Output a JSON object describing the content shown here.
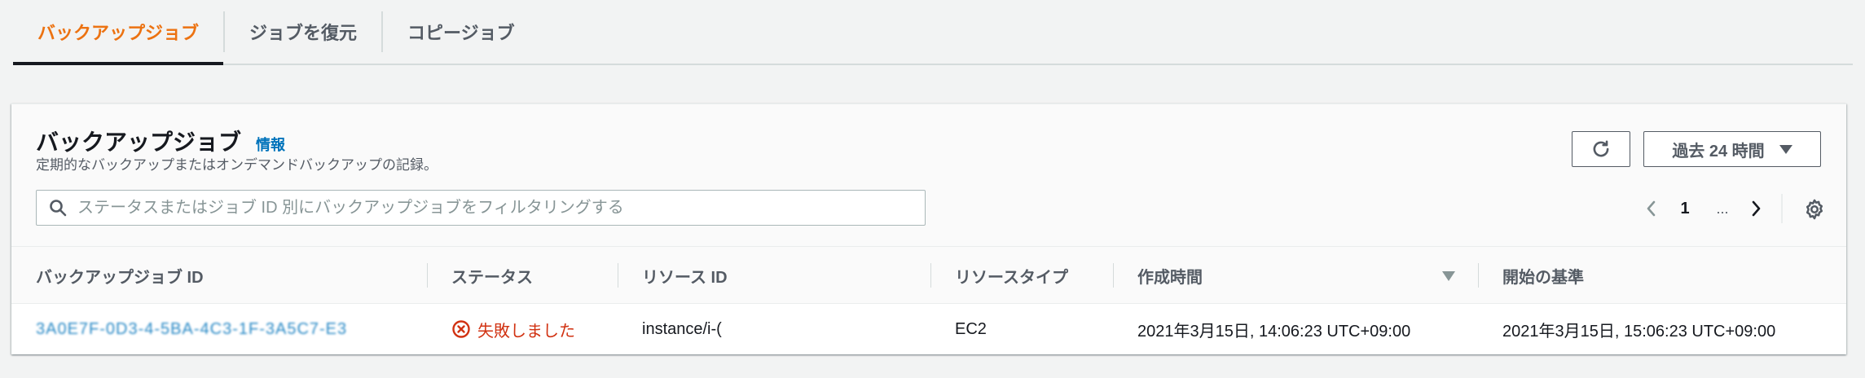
{
  "tabs": [
    {
      "label": "バックアップジョブ",
      "active": true
    },
    {
      "label": "ジョブを復元",
      "active": false
    },
    {
      "label": "コピージョブ",
      "active": false
    }
  ],
  "panel": {
    "title": "バックアップジョブ",
    "info_label": "情報",
    "description": "定期的なバックアップまたはオンデマンドバックアップの記録。",
    "time_range_label": "過去 24 時間"
  },
  "search": {
    "placeholder": "ステータスまたはジョブ ID 別にバックアップジョブをフィルタリングする",
    "value": ""
  },
  "pagination": {
    "current_page": "1",
    "ellipsis": "..."
  },
  "table": {
    "columns": [
      "バックアップジョブ ID",
      "ステータス",
      "リソース ID",
      "リソースタイプ",
      "作成時間",
      "開始の基準"
    ],
    "sorted_column": "作成時間",
    "rows": [
      {
        "job_id": "3A0E7F-0D3-4-5BA-4C3-1F-3A5C7-E3",
        "status": "失敗しました",
        "resource_id": "instance/i-(",
        "resource_type": "EC2",
        "created": "2021年3月15日, 14:06:23 UTC+09:00",
        "start_by": "2021年3月15日, 15:06:23 UTC+09:00"
      }
    ]
  },
  "colors": {
    "accent": "#ec7211",
    "link": "#0073bb",
    "error": "#d13212",
    "text_secondary": "#545b64"
  },
  "icons": [
    "refresh-icon",
    "caret-down-icon",
    "search-icon",
    "chevron-left-icon",
    "chevron-right-icon",
    "gear-icon",
    "sort-descending-icon",
    "status-error-icon"
  ]
}
